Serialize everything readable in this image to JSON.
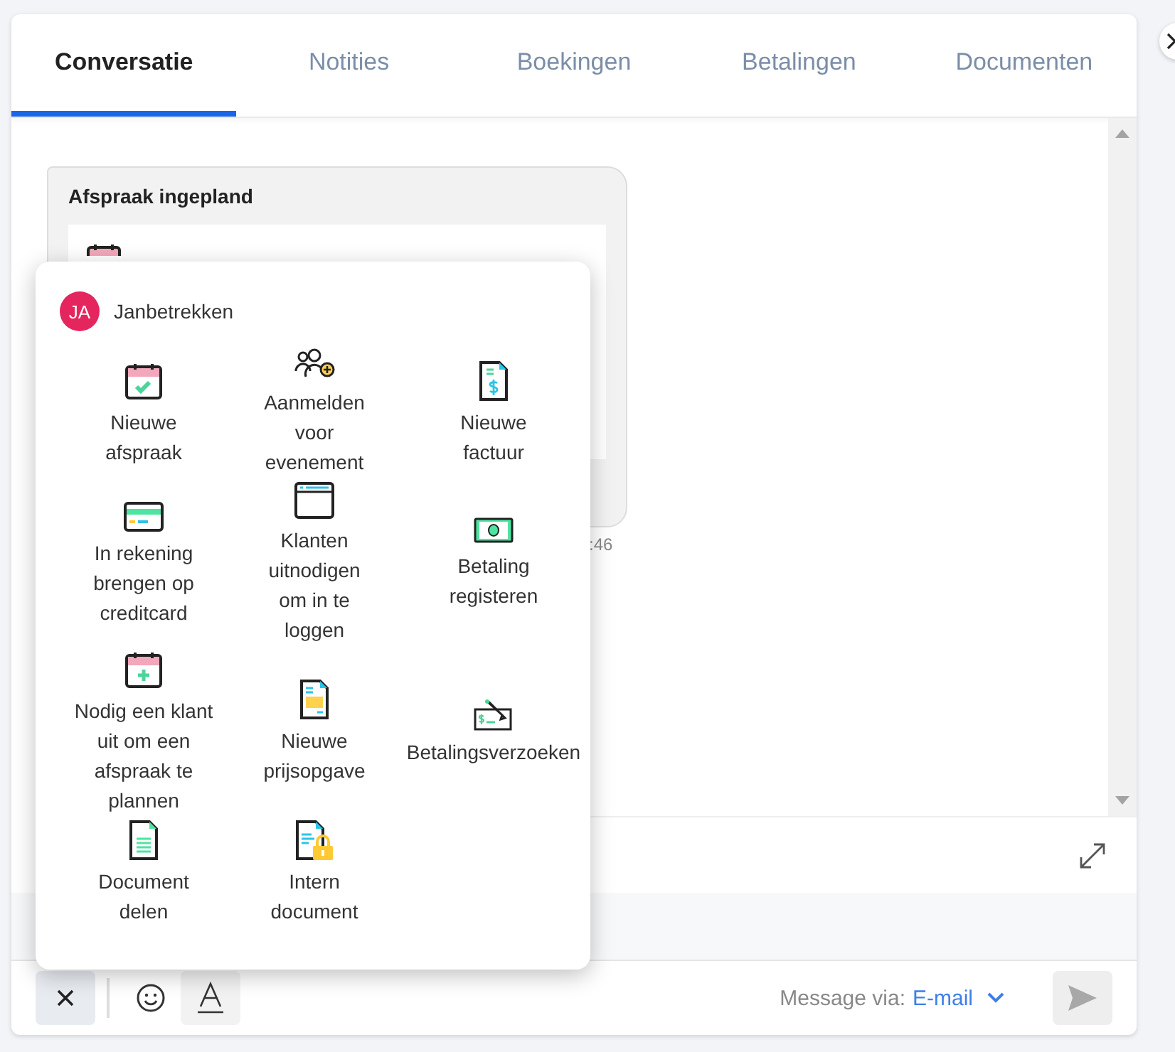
{
  "tabs": [
    {
      "label": "Conversatie",
      "selected": true
    },
    {
      "label": "Notities",
      "selected": false
    },
    {
      "label": "Boekingen",
      "selected": false
    },
    {
      "label": "Betalingen",
      "selected": false
    },
    {
      "label": "Documenten",
      "selected": false
    }
  ],
  "message": {
    "title": "Afspraak ingepland",
    "time": ":46"
  },
  "popup": {
    "avatar": "JA",
    "user": "Janbetrekken",
    "actions": [
      {
        "label": "Nieuwe afspraak"
      },
      {
        "label": "Aanmelden voor evenement"
      },
      {
        "label": "Nieuwe factuur"
      },
      {
        "label": "In rekening brengen op creditcard"
      },
      {
        "label": "Klanten uitnodigen om in te loggen"
      },
      {
        "label": "Betaling registeren"
      },
      {
        "label": "Nodig een klant uit om een afspraak te plannen"
      },
      {
        "label": "Nieuwe prijsopgave"
      },
      {
        "label": "Betalingsverzoeken"
      },
      {
        "label": "Document delen"
      },
      {
        "label": "Intern document"
      }
    ]
  },
  "composer": {
    "via_label": "Message via:",
    "via_value": "E-mail"
  }
}
